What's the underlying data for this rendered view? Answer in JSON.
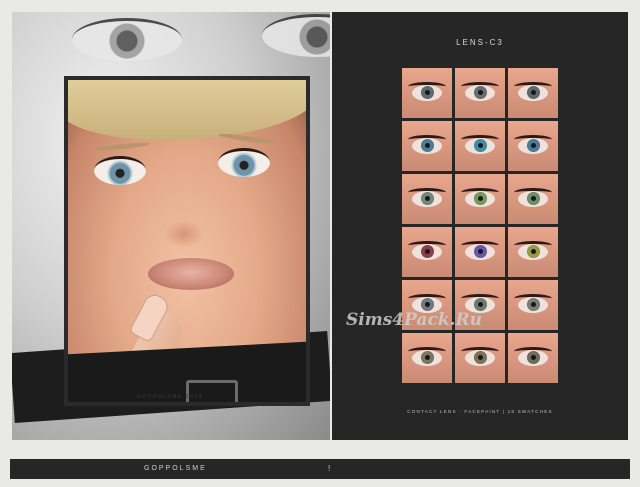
{
  "left_panel": {
    "credit": "GOPPOLSME 2024"
  },
  "right_panel": {
    "title": "LENS-C3",
    "footer": "CONTACT LENS · FACEPAINT | 18 SWATCHES",
    "watermark": "Sims4Pack.Ru",
    "swatch_iris_colors": [
      "#5f6b73",
      "#6a6e6f",
      "#60686c",
      "#4f7d96",
      "#3e8fa6",
      "#4d7a98",
      "#6f8a7d",
      "#789a5a",
      "#6b8f6a",
      "#8a3f4a",
      "#6a55b5",
      "#9a9a4a",
      "#707a80",
      "#6d7c6b",
      "#7a7f76",
      "#7d7660",
      "#7a7358",
      "#6f6c5e"
    ]
  },
  "bottom_bar": {
    "brand": "GOPPOLSME",
    "mark": "!"
  }
}
